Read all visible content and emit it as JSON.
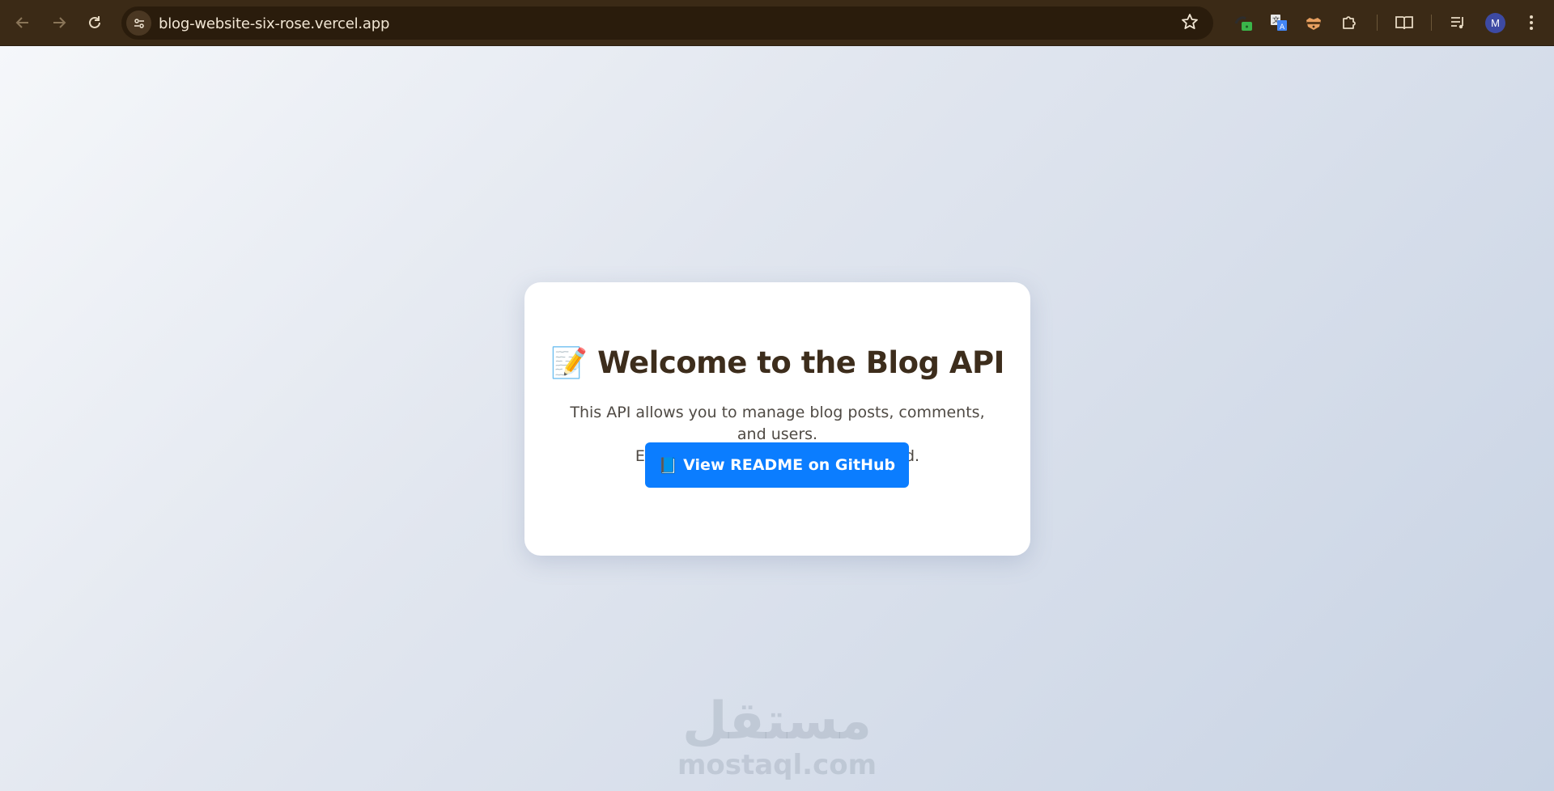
{
  "browser": {
    "url": "blog-website-six-rose.vercel.app",
    "profile_initial": "M",
    "icons": {
      "back": "arrow-left-icon",
      "forward": "arrow-right-icon",
      "reload": "reload-icon",
      "site_info": "tune-icon",
      "bookmark": "star-icon",
      "extensions": [
        "extension-green-icon",
        "translate-icon",
        "fox-extension-icon",
        "puzzle-extensions-icon"
      ],
      "reading_list": "reading-mode-icon",
      "media": "media-queue-icon",
      "menu": "kebab-menu-icon"
    },
    "colors": {
      "toolbar": "#3b2a16",
      "omnibox": "#2a1c0c"
    }
  },
  "card": {
    "emoji": "📝",
    "title": "Welcome to the Blog API",
    "description_line1": "This API allows you to manage blog posts, comments, and users.",
    "description_line2": "Explore the endpoints to get started.",
    "button_emoji": "📘",
    "button_label": "View README on GitHub",
    "button_color": "#0b7dff"
  },
  "watermark": {
    "arabic": "مستقل",
    "latin": "mostaql.com"
  }
}
